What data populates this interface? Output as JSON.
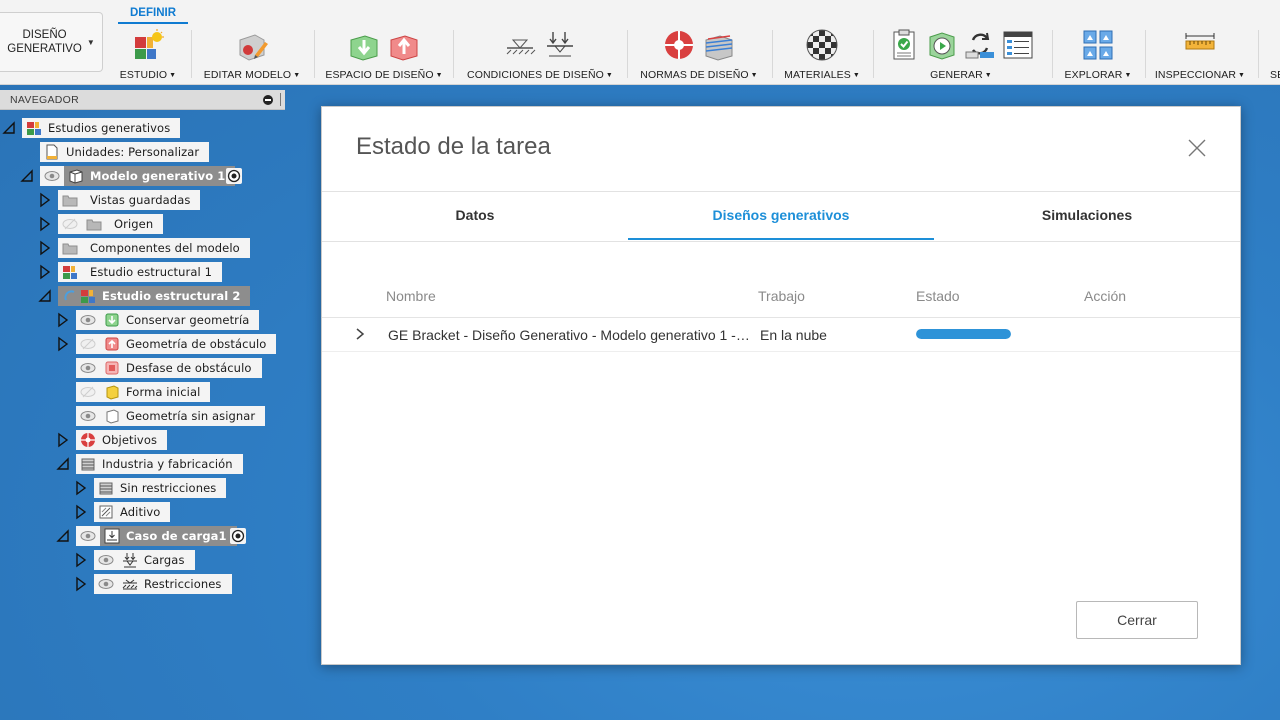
{
  "toolbar": {
    "workspace_label": "DISEÑO\nGENERATIVO",
    "active_tab": "DEFINIR",
    "groups": [
      {
        "label": "ESTUDIO",
        "icon": "generative-study-icon"
      },
      {
        "label": "EDITAR MODELO",
        "icon": "edit-model-icon"
      },
      {
        "label": "ESPACIO DE DISEÑO",
        "icon": "design-space-icon"
      },
      {
        "label": "CONDICIONES DE DISEÑO",
        "icon": "design-conditions-icon"
      },
      {
        "label": "NORMAS DE DISEÑO",
        "icon": "design-rules-icon"
      },
      {
        "label": "MATERIALES",
        "icon": "materials-icon"
      },
      {
        "label": "GENERAR",
        "icon": "generate-icon"
      },
      {
        "label": "EXPLORAR",
        "icon": "explore-icon"
      },
      {
        "label": "INSPECCIONAR",
        "icon": "inspect-icon"
      },
      {
        "label": "SE",
        "icon": ""
      }
    ]
  },
  "navigator": {
    "title": "NAVEGADOR",
    "items": [
      {
        "label": "Estudios generativos"
      },
      {
        "label": "Unidades: Personalizar"
      },
      {
        "label": "Modelo generativo 1"
      },
      {
        "label": "Vistas guardadas"
      },
      {
        "label": "Origen"
      },
      {
        "label": "Componentes del modelo"
      },
      {
        "label": "Estudio estructural 1"
      },
      {
        "label": "Estudio estructural 2"
      },
      {
        "label": "Conservar geometría"
      },
      {
        "label": "Geometría de obstáculo"
      },
      {
        "label": "Desfase de obstáculo"
      },
      {
        "label": "Forma inicial"
      },
      {
        "label": "Geometría sin asignar"
      },
      {
        "label": "Objetivos"
      },
      {
        "label": "Industria y fabricación"
      },
      {
        "label": "Sin restricciones"
      },
      {
        "label": "Aditivo"
      },
      {
        "label": "Caso de carga1"
      },
      {
        "label": "Cargas"
      },
      {
        "label": "Restricciones"
      }
    ]
  },
  "dialog": {
    "title": "Estado de la tarea",
    "tabs": [
      {
        "label": "Datos"
      },
      {
        "label": "Diseños generativos",
        "active": true
      },
      {
        "label": "Simulaciones"
      }
    ],
    "columns": {
      "name": "Nombre",
      "job": "Trabajo",
      "status": "Estado",
      "action": "Acción"
    },
    "rows": [
      {
        "name": "GE Bracket - Diseño Generativo - Modelo generativo 1 -…",
        "job": "En la nube",
        "progress": 1.0,
        "action": ""
      }
    ],
    "close_button": "Cerrar"
  },
  "colors": {
    "accent": "#1d8fd8",
    "progress": "#2e93d8",
    "background": "#2f7fc6",
    "selected_node": "#8d8d8d"
  }
}
